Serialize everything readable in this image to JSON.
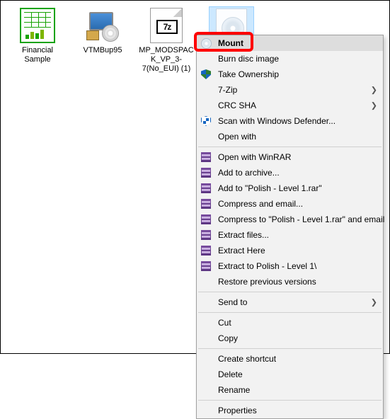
{
  "files": [
    {
      "label": "Financial Sample"
    },
    {
      "label": "VTMBup95"
    },
    {
      "label": "MP_MODSPACK_VP_3-7(No_EUI) (1)"
    },
    {
      "label": ""
    }
  ],
  "sevenz_badge": "7z",
  "ctx": {
    "mount": "Mount",
    "burn": "Burn disc image",
    "take_ownership": "Take Ownership",
    "seven_zip": "7-Zip",
    "crc_sha": "CRC SHA",
    "defender": "Scan with Windows Defender...",
    "open_with": "Open with",
    "open_winrar": "Open with WinRAR",
    "add_archive": "Add to archive...",
    "add_to_rar": "Add to \"Polish - Level 1.rar\"",
    "compress_email": "Compress and email...",
    "compress_to_email": "Compress to \"Polish - Level 1.rar\" and email",
    "extract_files": "Extract files...",
    "extract_here": "Extract Here",
    "extract_to": "Extract to Polish - Level 1\\",
    "restore": "Restore previous versions",
    "send_to": "Send to",
    "cut": "Cut",
    "copy": "Copy",
    "shortcut": "Create shortcut",
    "delete": "Delete",
    "rename": "Rename",
    "properties": "Properties"
  }
}
